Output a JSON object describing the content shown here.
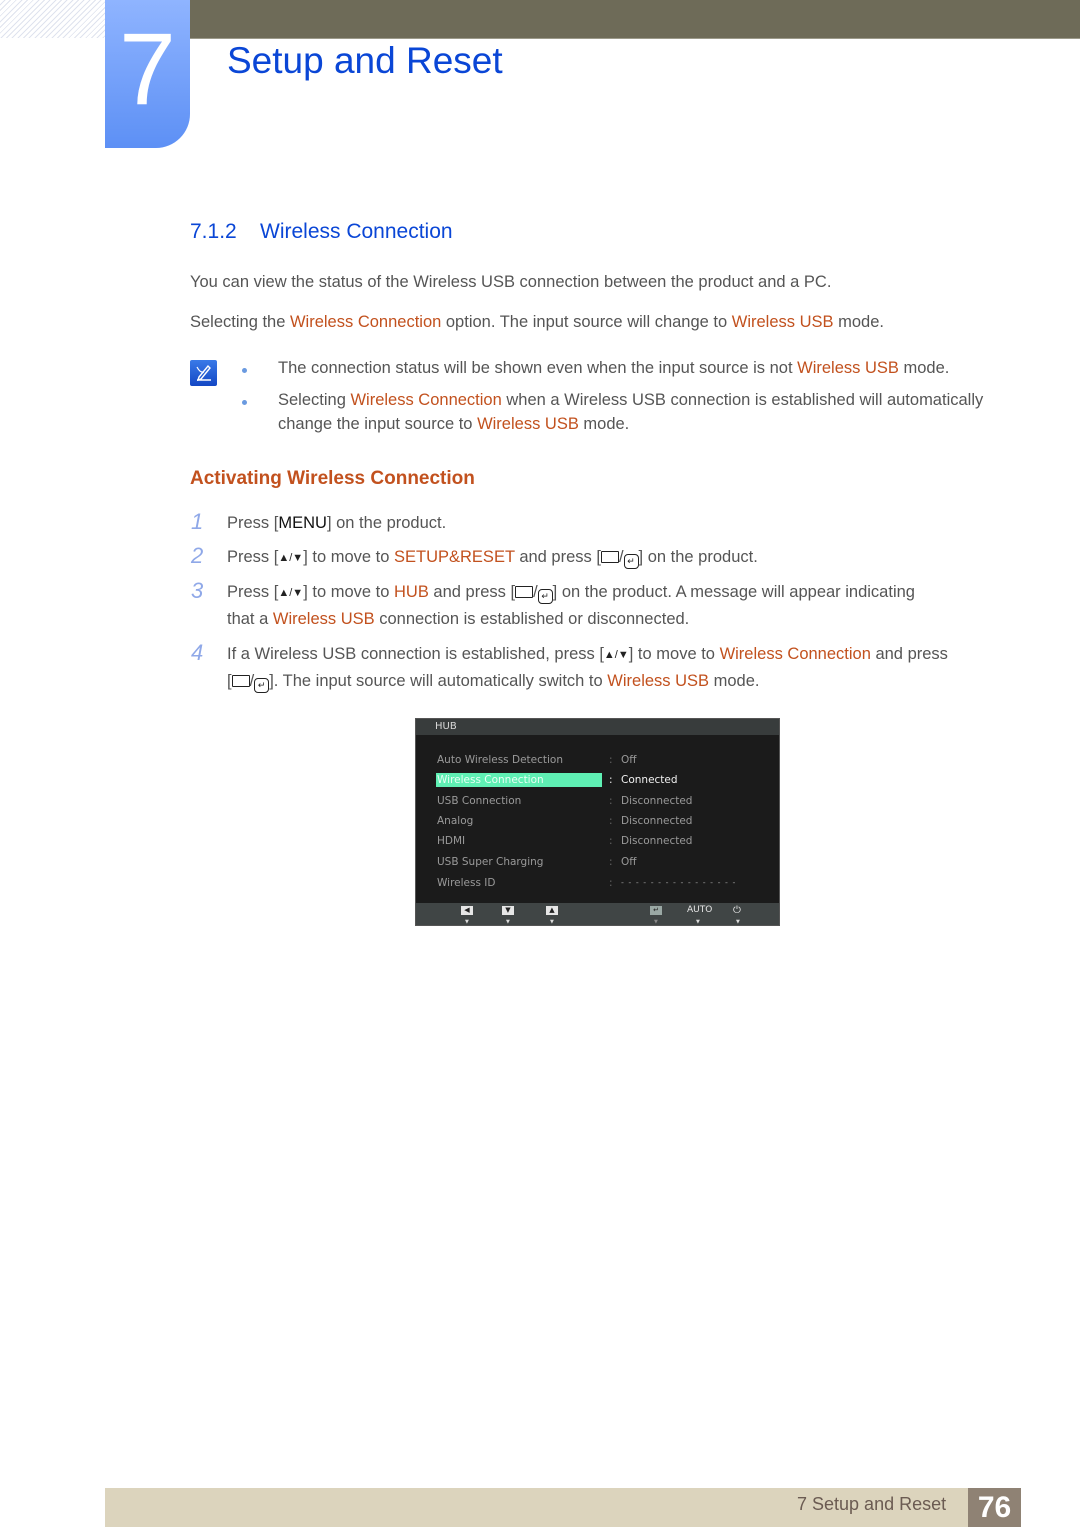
{
  "header": {
    "chapter_number": "7",
    "chapter_title": "Setup and Reset"
  },
  "section": {
    "number": "7.1.2",
    "title": "Wireless Connection"
  },
  "intro": {
    "p1": "You can view the status of the Wireless USB connection between the product and a PC.",
    "p2_a": "Selecting the ",
    "p2_hl1": "Wireless Connection",
    "p2_b": " option. The input source will change to ",
    "p2_hl2": "Wireless USB",
    "p2_c": " mode."
  },
  "notes": {
    "icon": "note-pencil-icon",
    "items": [
      {
        "a": "The connection status will be shown even when the input source is not ",
        "hl": "Wireless USB",
        "b": " mode."
      },
      {
        "a": "Selecting ",
        "hl": "Wireless Connection",
        "b": " when a Wireless USB connection is established will automatically",
        "line2_a": "change the input source to ",
        "line2_hl": "Wireless USB",
        "line2_b": " mode."
      }
    ]
  },
  "subsection": {
    "title": "Activating Wireless Connection"
  },
  "steps": [
    {
      "num": "1",
      "a": "Press [",
      "key": "MENU",
      "b": "] on the product."
    },
    {
      "num": "2",
      "a": "Press [",
      "b": "] to move to ",
      "hl": "SETUP&RESET",
      "c": " and press [",
      "d": "] on the product."
    },
    {
      "num": "3",
      "a": "Press [",
      "b": "] to move to ",
      "hl": "HUB",
      "c": " and press [",
      "d": "] on the product. A message will appear indicating",
      "line2_a": "that a ",
      "line2_hl": "Wireless USB",
      "line2_b": " connection is established or disconnected."
    },
    {
      "num": "4",
      "a": "If a Wireless USB connection is established, press [",
      "b": "] to move to ",
      "hl": "Wireless Connection",
      "c": " and press",
      "line2_a": "[",
      "line2_b": "]. The input source will automatically switch to ",
      "line2_hl": "Wireless USB",
      "line2_c": " mode."
    }
  ],
  "symbols": {
    "updown": "▲/▼",
    "enter_sep": "/",
    "enter_glyph": "↵"
  },
  "osd": {
    "title": "HUB",
    "rows": [
      {
        "label": "Auto Wireless Detection",
        "value": "Off"
      },
      {
        "label": "Wireless Connection",
        "value": "Connected",
        "selected": true
      },
      {
        "label": "USB Connection",
        "value": "Disconnected"
      },
      {
        "label": "Analog",
        "value": "Disconnected"
      },
      {
        "label": "HDMI",
        "value": "Disconnected"
      },
      {
        "label": "USB Super Charging",
        "value": "Off"
      },
      {
        "label": "Wireless ID",
        "value": "- - - - - - - - - - - - - - - -"
      }
    ],
    "colon": ":",
    "footer": {
      "left": "◀",
      "down": "▼",
      "up": "▲",
      "enter": "↵",
      "auto": "AUTO",
      "power": "⏻",
      "dot": "▼"
    },
    "highlight_color": "#5ff0b4"
  },
  "footer": {
    "text": "7 Setup and Reset",
    "page": "76"
  }
}
